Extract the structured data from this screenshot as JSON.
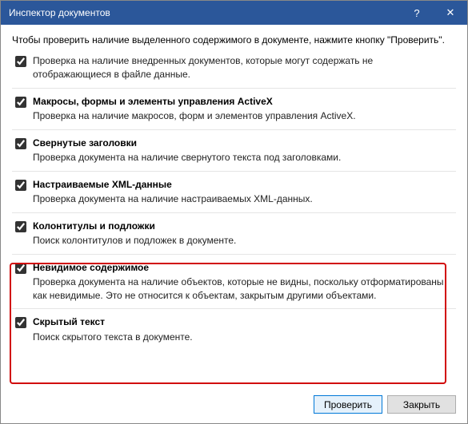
{
  "titlebar": {
    "title": "Инспектор документов",
    "help": "?",
    "close": "✕"
  },
  "instruction": "Чтобы проверить наличие выделенного содержимого в документе, нажмите кнопку \"Проверить\".",
  "items": [
    {
      "title": "",
      "desc": "Проверка на наличие внедренных документов, которые могут содержать не отображающиеся в файле данные.",
      "checked": true
    },
    {
      "title": "Макросы, формы и элементы управления ActiveX",
      "desc": "Проверка на наличие макросов, форм и элементов управления ActiveX.",
      "checked": true
    },
    {
      "title": "Свернутые заголовки",
      "desc": "Проверка документа на наличие свернутого текста под заголовками.",
      "checked": true
    },
    {
      "title": "Настраиваемые XML-данные",
      "desc": "Проверка документа на наличие настраиваемых XML-данных.",
      "checked": true
    },
    {
      "title": "Колонтитулы и подложки",
      "desc": "Поиск колонтитулов и подложек в документе.",
      "checked": true
    },
    {
      "title": "Невидимое содержимое",
      "desc": "Проверка документа на наличие объектов, которые не видны, поскольку отформатированы как невидимые. Это не относится к объектам, закрытым другими объектами.",
      "checked": true
    },
    {
      "title": "Скрытый текст",
      "desc": "Поиск скрытого текста в документе.",
      "checked": true
    }
  ],
  "footer": {
    "inspect": "Проверить",
    "close": "Закрыть"
  }
}
